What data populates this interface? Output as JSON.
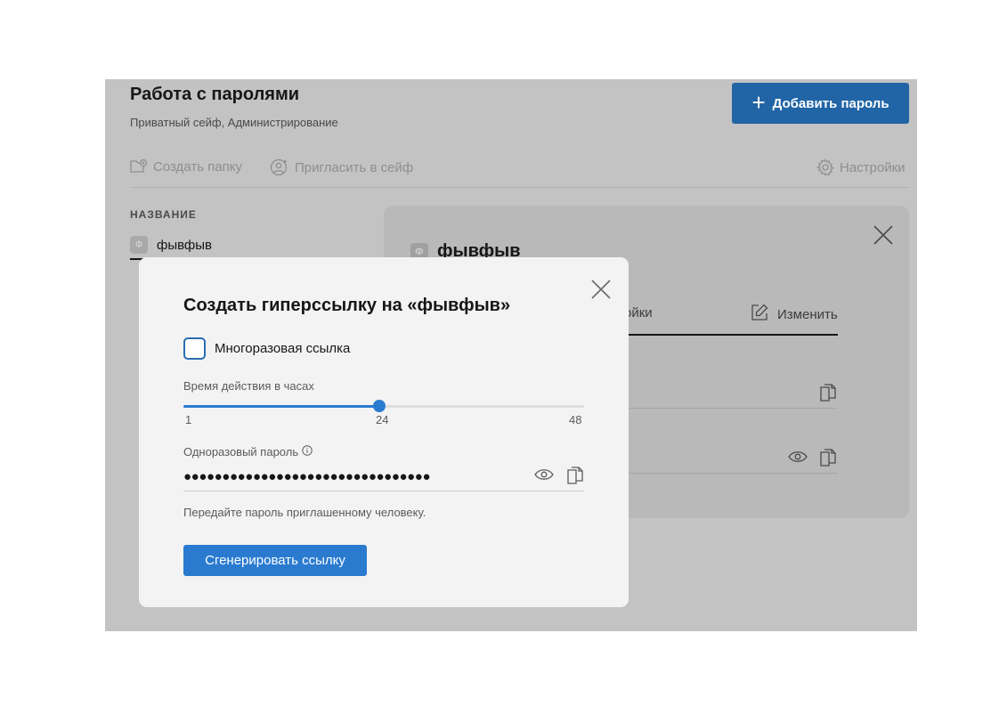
{
  "header": {
    "title": "Работа с паролями",
    "subtitle": "Приватный сейф, Администрирование",
    "add_button_label": "Добавить пароль"
  },
  "toolbar": {
    "create_folder": "Создать папку",
    "invite": "Пригласить в сейф",
    "settings": "Настройки"
  },
  "list": {
    "column_header": "НАЗВАНИЕ",
    "items": [
      {
        "badge": "Ф",
        "name": "фывфыв"
      }
    ]
  },
  "detail": {
    "badge": "Ф",
    "title": "фывфыв",
    "tab_partial": "ойки",
    "edit_label": "Изменить"
  },
  "modal": {
    "title": "Создать гиперссылку на «фывфыв»",
    "multiuse_label": "Многоразовая ссылка",
    "multiuse_checked": false,
    "slider": {
      "label": "Время действия в часах",
      "min": 1,
      "max": 48,
      "value": 24,
      "ticks": [
        "1",
        "24",
        "48"
      ]
    },
    "otp": {
      "label": "Одноразовый пароль",
      "value": "●●●●●●●●●●●●●●●●●●●●●●●●●●●●●●●●"
    },
    "hint": "Передайте пароль приглашенному человеку.",
    "generate_label": "Сгенерировать ссылку"
  },
  "colors": {
    "accent": "#2a7bd0",
    "primary_dark": "#2165a6",
    "overlay": "#c3c3c3",
    "modal_bg": "#f3f3f3"
  }
}
